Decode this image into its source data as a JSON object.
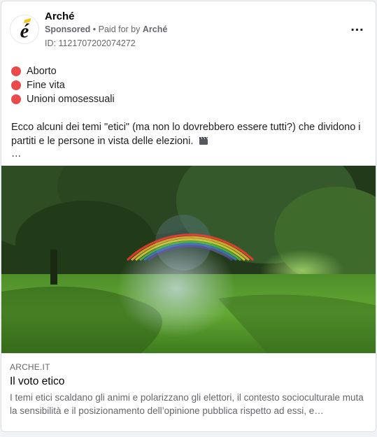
{
  "header": {
    "page_name": "Arché",
    "sponsored_label": "Sponsored",
    "separator": " • ",
    "paid_for_prefix": "Paid for by ",
    "paid_for_name": "Arché",
    "ad_id": "ID: 1121707202074272",
    "more_icon": "more-horizontal-icon",
    "avatar_logo_letter": "é"
  },
  "body": {
    "topics": [
      "Aborto",
      "Fine vita",
      "Unioni omosessuali"
    ],
    "topic_bullet_color": "#e94b4b",
    "paragraph": "Ecco alcuni dei temi \"etici\" (ma non lo dovrebbero essere tutti?) che dividono i partiti e le persone in vista delle elezioni.",
    "paragraph_emoji": "clapper-board-icon",
    "truncation": "…"
  },
  "media": {
    "description_icon": "park-rainbow-photo"
  },
  "link_preview": {
    "domain": "ARCHE.IT",
    "title": "Il voto etico",
    "description": "I temi etici scaldano gli animi e polarizzano gli elettori, il contesto socioculturale muta la sensibilità e il posizionamento dell’opinione pubblica rispetto ad essi, e…"
  }
}
